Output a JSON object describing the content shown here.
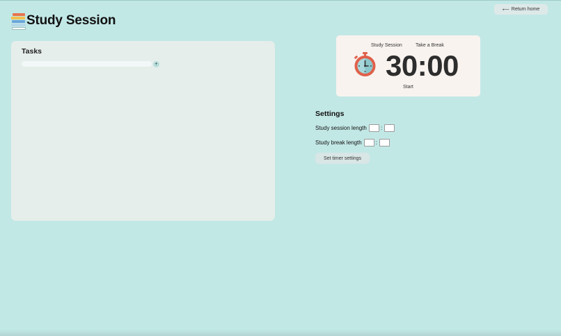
{
  "header": {
    "title": "Study Session",
    "logo_icon": "book-stack-icon",
    "return_label": "Return home",
    "return_arrow": "⟵"
  },
  "tasks": {
    "title": "Tasks",
    "input_placeholder": "",
    "add_label": "+"
  },
  "timer": {
    "tabs": [
      "Study Session",
      "Take a Break"
    ],
    "display": "30:00",
    "start_label": "Start",
    "icon": "stopwatch-icon"
  },
  "settings": {
    "title": "Settings",
    "study_label": "Study session length",
    "break_label": "Study break length",
    "separator": ":",
    "button_label": "Set timer settings"
  },
  "colors": {
    "background": "#c2e8e6",
    "panel": "#e5eeea",
    "timer_card": "#f8f3ef",
    "stopwatch_red": "#e0604a",
    "stopwatch_face": "#a9d8dc"
  }
}
